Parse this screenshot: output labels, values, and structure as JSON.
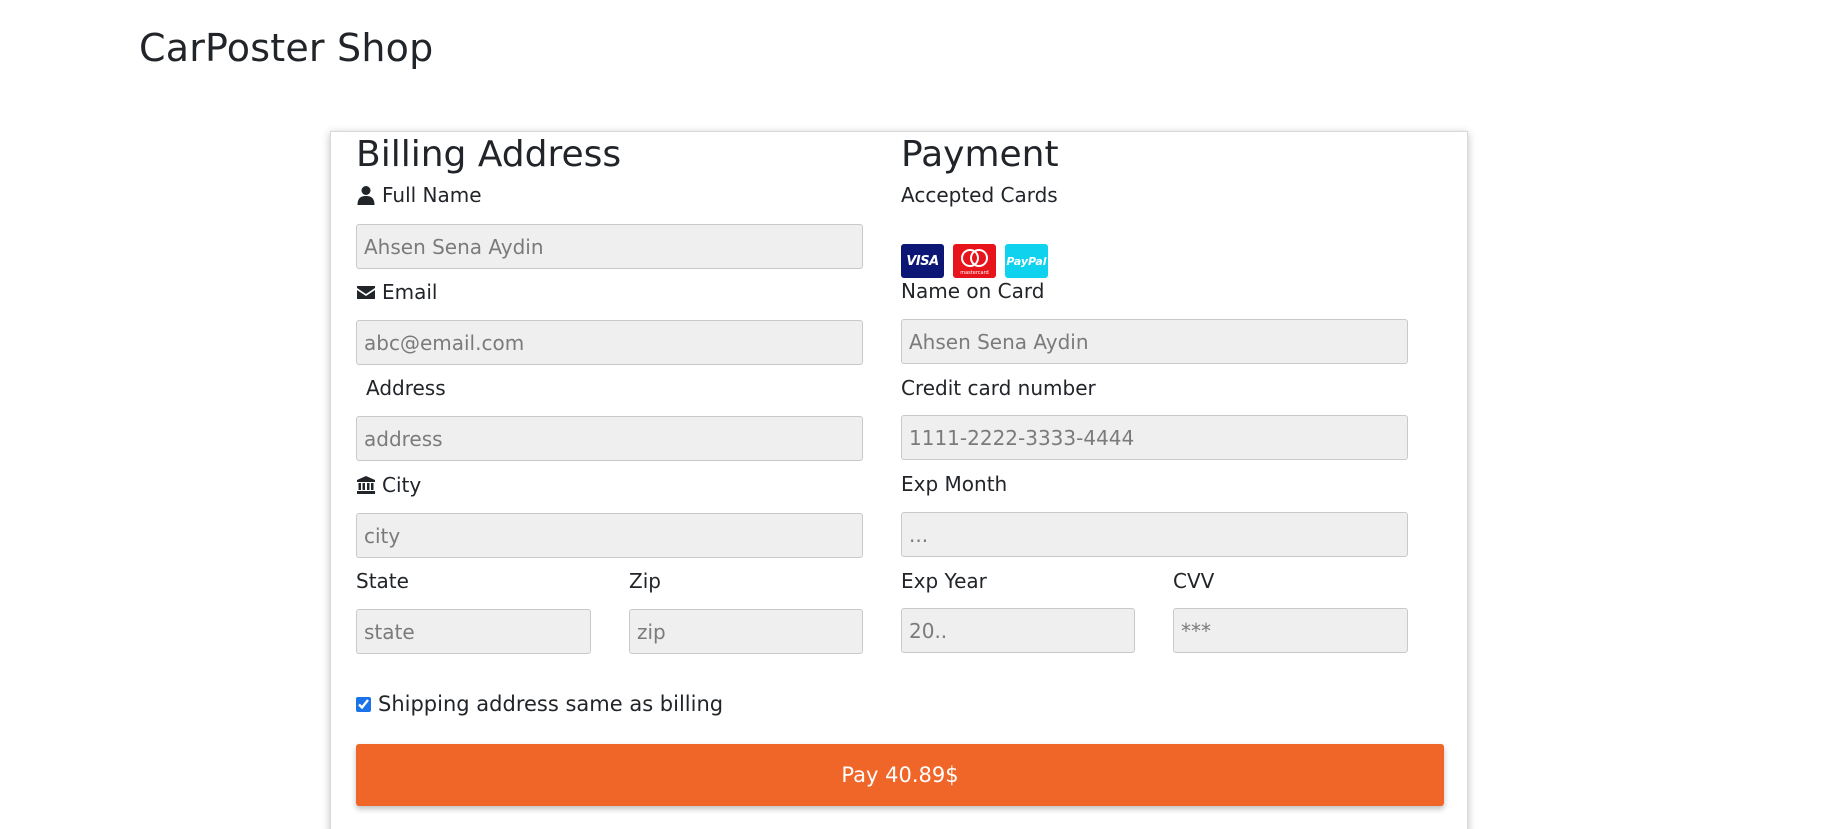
{
  "brand": "CarPoster Shop",
  "billing": {
    "title": "Billing Address",
    "full_name": {
      "label": "Full Name",
      "placeholder": "Ahsen Sena Aydin",
      "icon": "user-icon"
    },
    "email": {
      "label": "Email",
      "placeholder": "abc@email.com",
      "icon": "envelope-icon"
    },
    "address": {
      "label": "Address",
      "placeholder": "address",
      "icon": "address-card-icon"
    },
    "city": {
      "label": "City",
      "placeholder": "city",
      "icon": "institution-icon"
    },
    "state": {
      "label": "State",
      "placeholder": "state"
    },
    "zip": {
      "label": "Zip",
      "placeholder": "zip"
    }
  },
  "payment": {
    "title": "Payment",
    "accepted_cards_label": "Accepted Cards",
    "cards": [
      "visa",
      "mastercard",
      "paypal"
    ],
    "card_texts": {
      "visa": "VISA",
      "mastercard": "mastercard",
      "paypal": "PayPal"
    },
    "name_on_card": {
      "label": "Name on Card",
      "placeholder": "Ahsen Sena Aydin"
    },
    "card_number": {
      "label": "Credit card number",
      "placeholder": "1111-2222-3333-4444"
    },
    "exp_month": {
      "label": "Exp Month",
      "placeholder": "..."
    },
    "exp_year": {
      "label": "Exp Year",
      "placeholder": "20.."
    },
    "cvv": {
      "label": "CVV",
      "placeholder": "***"
    }
  },
  "shipping_same": {
    "label": "Shipping address same as billing",
    "checked": true
  },
  "pay_button": "Pay 40.89$",
  "colors": {
    "accent": "#f06628",
    "visa": "#0b1675",
    "mastercard": "#e8141b",
    "paypal": "#0fd3ee"
  }
}
